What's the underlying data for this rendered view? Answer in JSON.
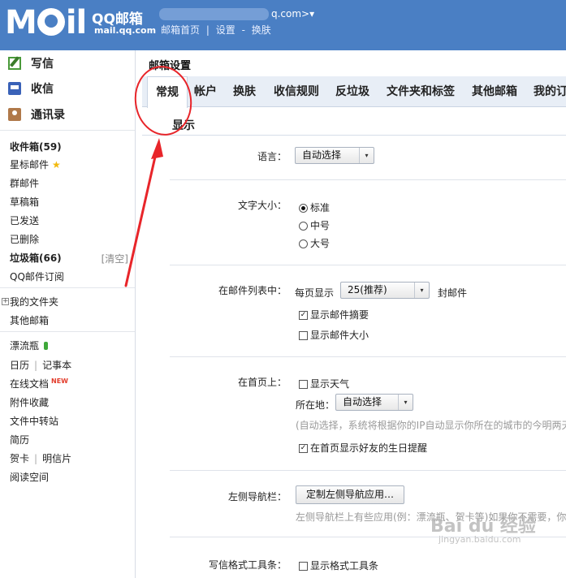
{
  "header": {
    "logo_text": "MAil",
    "brand": "QQ邮箱",
    "domain": "mail.qq.com",
    "account_suffix": "q.com>",
    "account_caret": "▾",
    "links": [
      "邮箱首页",
      "|",
      "设置",
      "-",
      "换肤"
    ]
  },
  "sidebar": {
    "quick": [
      {
        "label": "写信",
        "icon": "write-icon"
      },
      {
        "label": "收信",
        "icon": "inbox-icon"
      },
      {
        "label": "通讯录",
        "icon": "contacts-icon"
      }
    ],
    "inbox": "收件箱(59)",
    "starred": "星标邮件",
    "groups": "群邮件",
    "drafts": "草稿箱",
    "sent": "已发送",
    "deleted": "已删除",
    "spam": "垃圾箱(66)",
    "spam_clear": "[清空]",
    "subscribe": "QQ邮件订阅",
    "plus": "+",
    "my_folders": "我的文件夹",
    "other_mail": "其他邮箱",
    "drift_bottle": "漂流瓶",
    "calendar": "日历",
    "notes": "记事本",
    "online_docs": "在线文档",
    "new_badge": "NEW",
    "attachments": "附件收藏",
    "file_transfer": "文件中转站",
    "resume": "简历",
    "cards": "贺卡",
    "postcards": "明信片",
    "reading": "阅读空间",
    "pipe": "|"
  },
  "main": {
    "title": "邮箱设置",
    "tabs": [
      "常规",
      "帐户",
      "换肤",
      "收信规则",
      "反垃圾",
      "文件夹和标签",
      "其他邮箱",
      "我的订"
    ],
    "active_tab": 0,
    "subtab": "显示",
    "language": {
      "label": "语言：",
      "value": "自动选择"
    },
    "font_size": {
      "label": "文字大小：",
      "options": [
        "标准",
        "中号",
        "大号"
      ],
      "selected": 0
    },
    "mail_list": {
      "label": "在邮件列表中：",
      "per_page_prefix": "每页显示",
      "per_page_value": "25(推荐)",
      "per_page_suffix": "封邮件",
      "show_summary": "显示邮件摘要",
      "show_summary_checked": true,
      "show_size": "显示邮件大小",
      "show_size_checked": false
    },
    "homepage": {
      "label": "在首页上：",
      "show_weather": "显示天气",
      "show_weather_checked": false,
      "location_label": "所在地：",
      "location_value": "自动选择",
      "location_hint": "(自动选择，系统将根据你的IP自动显示你所在的城市的今明两天",
      "show_birthday": "在首页显示好友的生日提醒",
      "show_birthday_checked": true
    },
    "left_nav": {
      "label": "左侧导航栏：",
      "button": "定制左侧导航应用…",
      "hint": "左侧导航栏上有些应用(例：漂流瓶、贺卡等)如果你不需要，你"
    },
    "compose_toolbar": {
      "label": "写信格式工具条：",
      "option": "显示格式工具条",
      "checked": false
    },
    "arrow_glyph": "▾"
  },
  "watermark": {
    "brand": "Bai du 经验",
    "url": "jingyan.baidu.com"
  },
  "annotation_color": "#e8252a"
}
